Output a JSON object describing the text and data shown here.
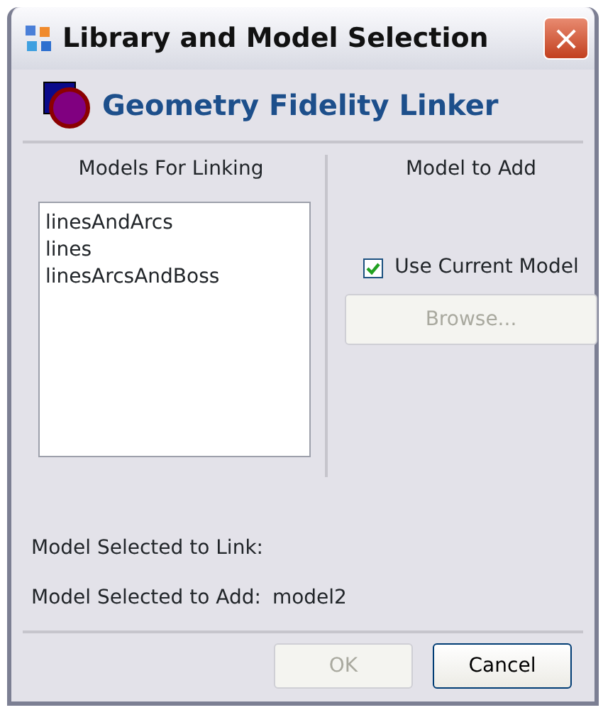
{
  "window": {
    "title": "Library and Model Selection",
    "close": "×"
  },
  "header": {
    "title": "Geometry Fidelity Linker"
  },
  "models_for_linking": {
    "heading": "Models For Linking",
    "items": [
      {
        "label": "linesAndArcs",
        "selected": false
      },
      {
        "label": "lines",
        "selected": false
      },
      {
        "label": "linesArcsAndBoss",
        "selected": false
      }
    ]
  },
  "model_to_add": {
    "heading": "Model to Add",
    "use_current": {
      "label": "Use Current Model",
      "checked": true
    },
    "browse": {
      "label": "Browse...",
      "disabled": true
    }
  },
  "selected_to_link": {
    "label": "Model Selected to Link:"
  },
  "selected_to_add": {
    "label": "Model Selected to Add:",
    "value": "model2"
  },
  "buttons": [
    {
      "label": "OK",
      "disabled": true
    },
    {
      "label": "Cancel",
      "disabled": false
    }
  ]
}
